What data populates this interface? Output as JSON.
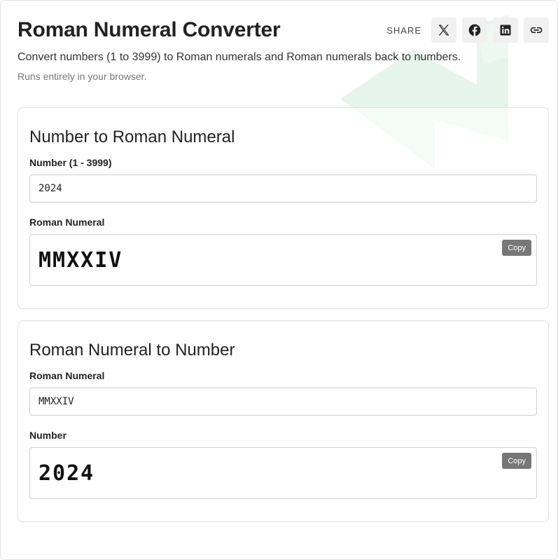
{
  "header": {
    "title": "Roman Numeral Converter",
    "subtitle": "Convert numbers (1 to 3999) to Roman numerals and Roman numerals back to numbers.",
    "note": "Runs entirely in your browser."
  },
  "share": {
    "label": "SHARE",
    "buttons": [
      {
        "icon": "x-twitter-icon"
      },
      {
        "icon": "facebook-icon"
      },
      {
        "icon": "linkedin-icon"
      },
      {
        "icon": "link-icon"
      }
    ]
  },
  "to_roman": {
    "heading": "Number to Roman Numeral",
    "input_label": "Number (1 - 3999)",
    "input_value": "2024",
    "output_label": "Roman Numeral",
    "output_value": "MMXXIV",
    "copy_label": "Copy"
  },
  "to_number": {
    "heading": "Roman Numeral to Number",
    "input_label": "Roman Numeral",
    "input_value": "MMXXIV",
    "output_label": "Number",
    "output_value": "2024",
    "copy_label": "Copy"
  },
  "colors": {
    "watermark": "#e6f5ec",
    "copy_button": "#777777",
    "share_button_bg": "#f0f0f0"
  }
}
